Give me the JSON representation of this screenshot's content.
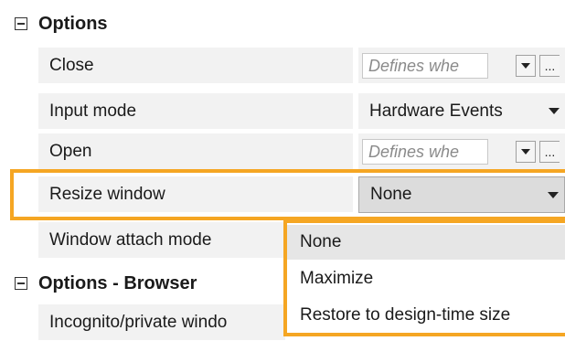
{
  "sections": {
    "options": {
      "title": "Options"
    },
    "options_browser": {
      "title": "Options - Browser"
    }
  },
  "rows": {
    "close": {
      "label": "Close",
      "placeholder": "Defines whe",
      "dropdown_icon": "chevron-down-icon",
      "browse_label": "..."
    },
    "input_mode": {
      "label": "Input mode",
      "value": "Hardware Events"
    },
    "open": {
      "label": "Open",
      "placeholder": "Defines whe",
      "dropdown_icon": "chevron-down-icon",
      "browse_label": "..."
    },
    "resize_window": {
      "label": "Resize window",
      "value": "None"
    },
    "window_attach_mode": {
      "label": "Window attach mode"
    },
    "incognito": {
      "label": "Incognito/private windo"
    }
  },
  "dropdown": {
    "items": [
      "None",
      "Maximize",
      "Restore to design-time size"
    ],
    "selected": "None"
  },
  "colors": {
    "highlight": "#f5a623",
    "row_background": "#f2f2f2",
    "placeholder_text": "#8a8a8a"
  }
}
